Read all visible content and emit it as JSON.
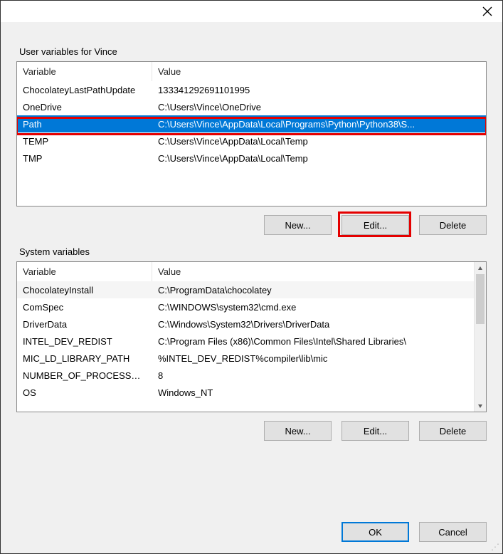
{
  "sections": {
    "user_label": "User variables for Vince",
    "system_label": "System variables"
  },
  "columns": {
    "variable": "Variable",
    "value": "Value"
  },
  "user_vars": [
    {
      "name": "ChocolateyLastPathUpdate",
      "value": "133341292691101995"
    },
    {
      "name": "OneDrive",
      "value": "C:\\Users\\Vince\\OneDrive"
    },
    {
      "name": "Path",
      "value": "C:\\Users\\Vince\\AppData\\Local\\Programs\\Python\\Python38\\S..."
    },
    {
      "name": "TEMP",
      "value": "C:\\Users\\Vince\\AppData\\Local\\Temp"
    },
    {
      "name": "TMP",
      "value": "C:\\Users\\Vince\\AppData\\Local\\Temp"
    }
  ],
  "system_vars": [
    {
      "name": "ChocolateyInstall",
      "value": "C:\\ProgramData\\chocolatey"
    },
    {
      "name": "ComSpec",
      "value": "C:\\WINDOWS\\system32\\cmd.exe"
    },
    {
      "name": "DriverData",
      "value": "C:\\Windows\\System32\\Drivers\\DriverData"
    },
    {
      "name": "INTEL_DEV_REDIST",
      "value": "C:\\Program Files (x86)\\Common Files\\Intel\\Shared Libraries\\"
    },
    {
      "name": "MIC_LD_LIBRARY_PATH",
      "value": "%INTEL_DEV_REDIST%compiler\\lib\\mic"
    },
    {
      "name": "NUMBER_OF_PROCESSORS",
      "value": "8"
    },
    {
      "name": "OS",
      "value": "Windows_NT"
    }
  ],
  "buttons": {
    "new": "New...",
    "edit": "Edit...",
    "delete": "Delete",
    "ok": "OK",
    "cancel": "Cancel"
  },
  "selected_user_index": 2
}
